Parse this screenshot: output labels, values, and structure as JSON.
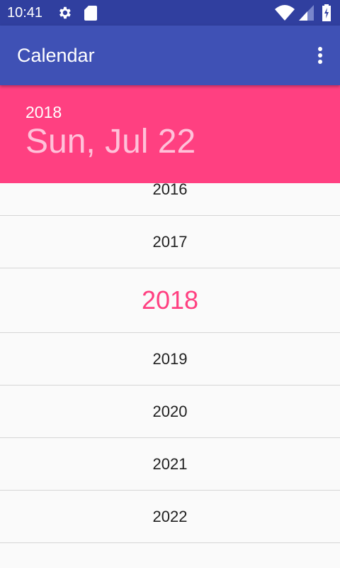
{
  "status_bar": {
    "time": "10:41",
    "icons": [
      "settings-icon",
      "sd-card-icon",
      "wifi-icon",
      "cell-signal-icon",
      "battery-charging-icon"
    ]
  },
  "app_bar": {
    "title": "Calendar",
    "menu_icon": "more-vert-icon"
  },
  "date_header": {
    "year": "2018",
    "date": "Sun, Jul 22"
  },
  "year_list": {
    "selected": "2018",
    "years": [
      "2016",
      "2017",
      "2018",
      "2019",
      "2020",
      "2021",
      "2022"
    ]
  },
  "colors": {
    "primary": "#3f51b5",
    "primary_dark": "#303f9f",
    "accent": "#ff4081"
  }
}
